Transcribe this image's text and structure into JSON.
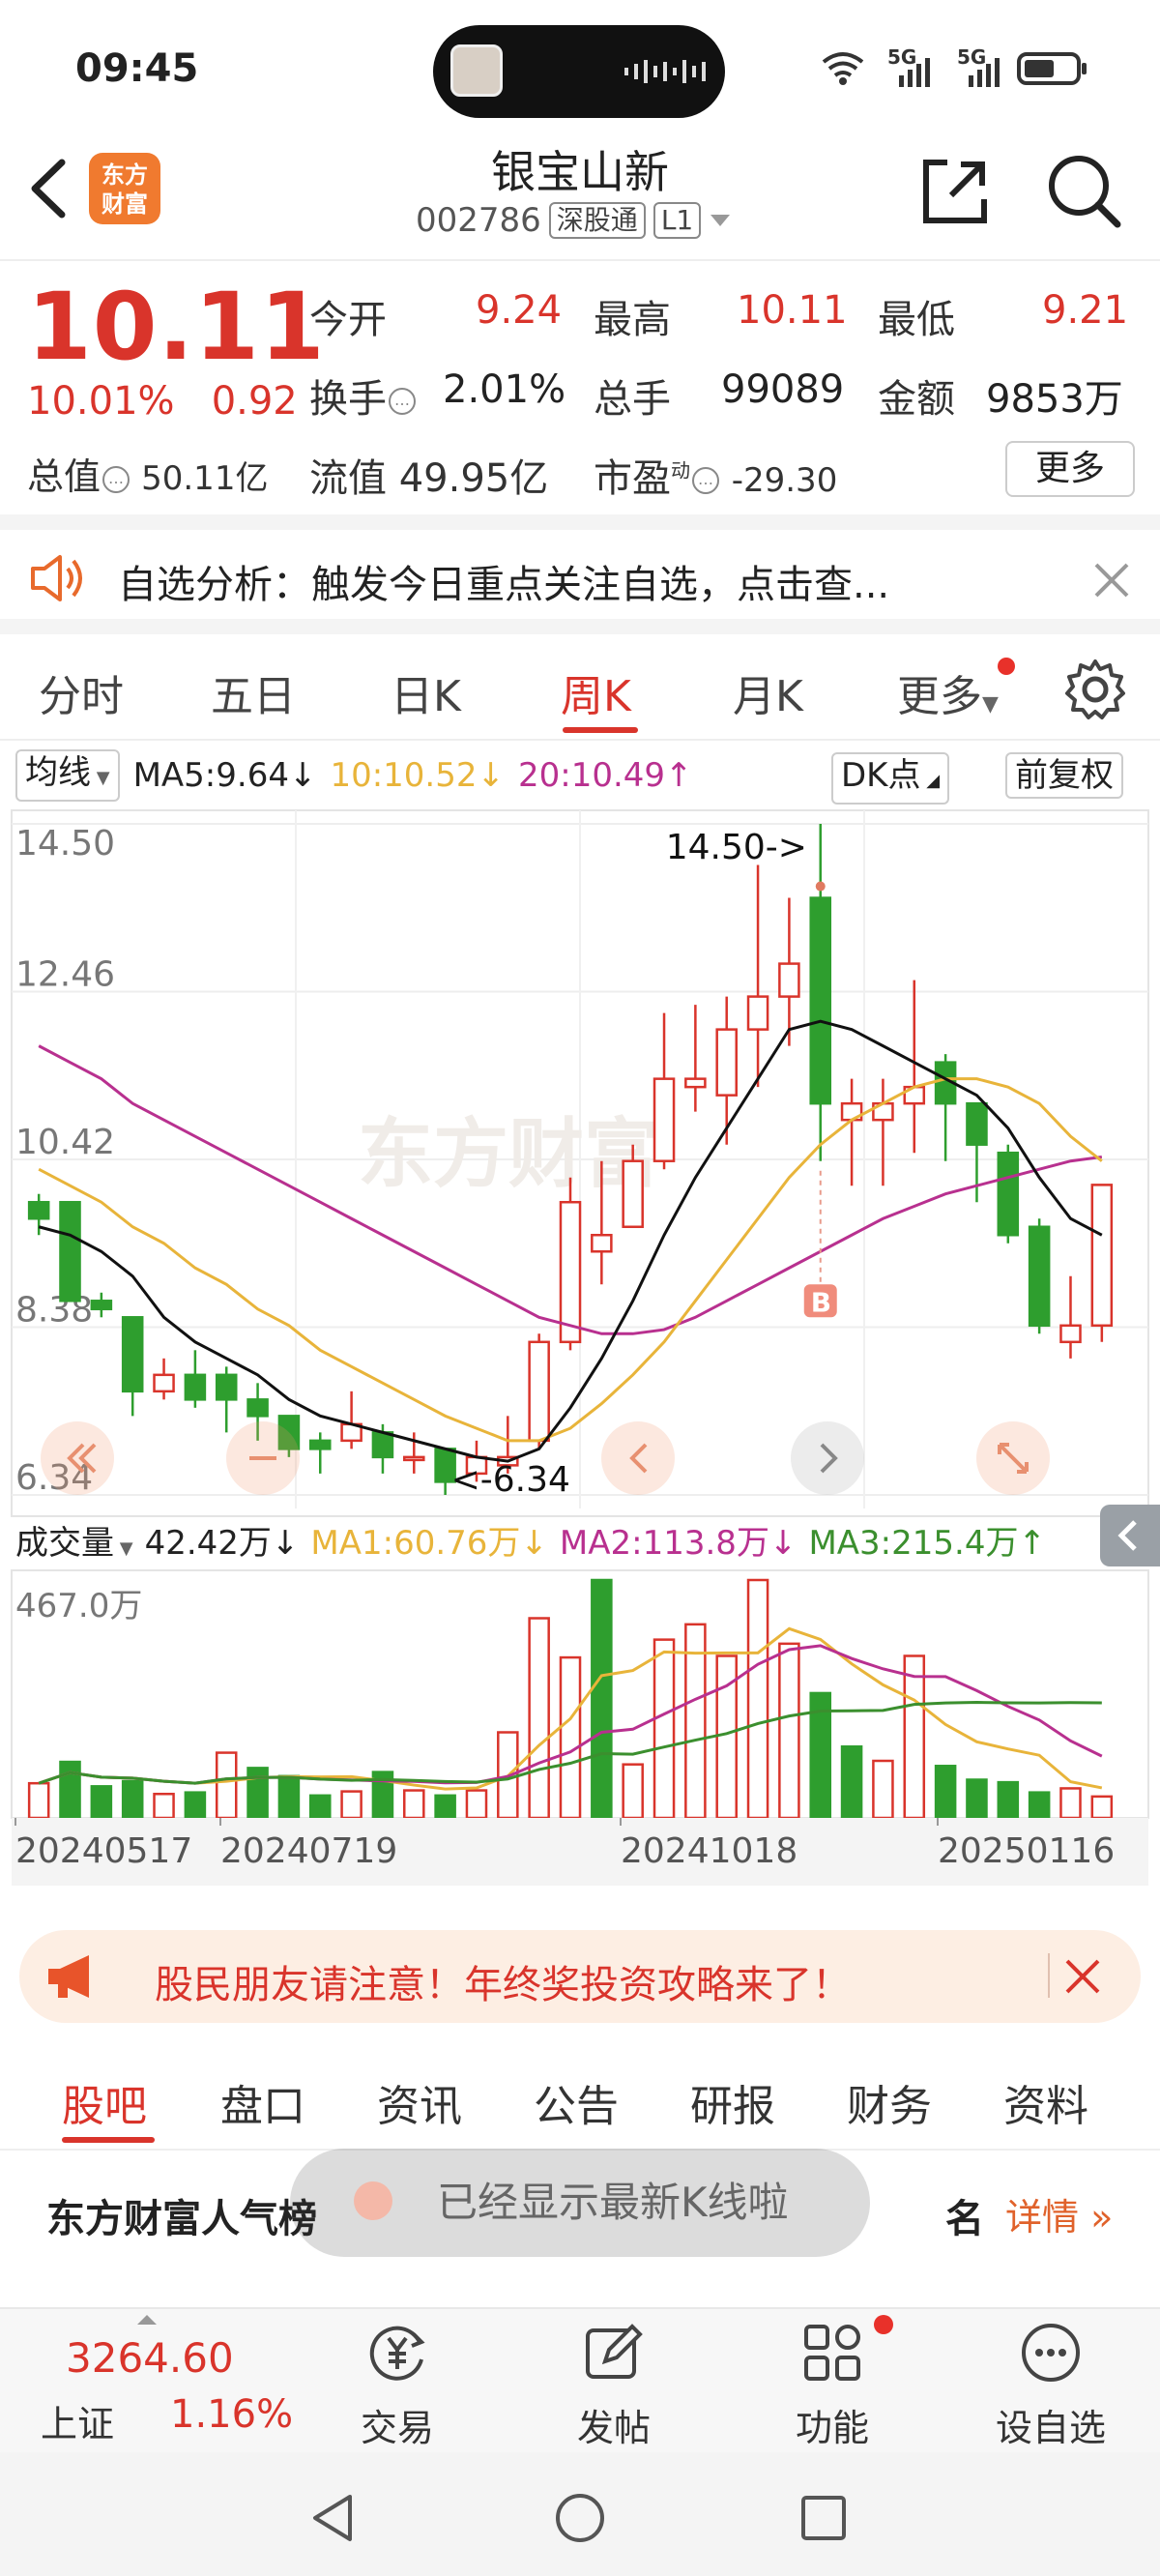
{
  "status": {
    "time": "09:45",
    "net1": "5G",
    "net2": "5G"
  },
  "header": {
    "logo_line1": "东方",
    "logo_line2": "财富",
    "title": "银宝山新",
    "code": "002786",
    "tag1": "深股通",
    "tag2": "L1"
  },
  "quote": {
    "price": "10.11",
    "change_pct": "10.01%",
    "change_amt": "0.92",
    "open_label": "今开",
    "open": "9.24",
    "high_label": "最高",
    "high": "10.11",
    "low_label": "最低",
    "low": "9.21",
    "turnover_label": "换手",
    "turnover": "2.01%",
    "volume_label": "总手",
    "volume": "99089",
    "amount_label": "金额",
    "amount": "9853万",
    "mktcap_label": "总值",
    "mktcap": "50.11亿",
    "float_label": "流值",
    "float": "49.95亿",
    "pe_label": "市盈",
    "pe_sup": "动",
    "pe": "-29.30",
    "more": "更多"
  },
  "alert": {
    "text": "自选分析：触发今日重点关注自选，点击查..."
  },
  "tabs": [
    "分时",
    "五日",
    "日K",
    "周K",
    "月K",
    "更多"
  ],
  "active_tab": "周K",
  "ma_bar": {
    "selector": "均线",
    "ma5": "MA5:9.64↓",
    "ma10": "10:10.52↓",
    "ma20": "20:10.49↑",
    "dk": "DK点",
    "fq": "前复权"
  },
  "vol_bar": {
    "selector": "成交量",
    "vol": "42.42万↓",
    "ma1": "MA1:60.76万↓",
    "ma2": "MA2:113.8万↓",
    "ma3": "MA3:215.4万↑"
  },
  "colors": {
    "up": "#d9342b",
    "down": "#2e9e2e",
    "ma5": "#111111",
    "ma10": "#e8b43a",
    "ma20": "#b8308f",
    "vma3": "#3b8f2e"
  },
  "chart_data": {
    "type": "candlestick",
    "y_ticks": [
      "14.50",
      "12.46",
      "10.42",
      "8.38",
      "6.34"
    ],
    "ylim": [
      6.34,
      14.5
    ],
    "x_labels": [
      "20240517",
      "20240719",
      "20241018",
      "20250116"
    ],
    "high_label": "14.50->",
    "low_label": "<-6.34",
    "marker": "B",
    "watermark": "东方财富",
    "candles": [
      {
        "o": 9.9,
        "c": 9.7,
        "h": 10.0,
        "l": 9.5
      },
      {
        "o": 9.9,
        "c": 8.7,
        "h": 9.9,
        "l": 8.7
      },
      {
        "o": 8.7,
        "c": 8.6,
        "h": 8.8,
        "l": 8.5
      },
      {
        "o": 8.5,
        "c": 7.6,
        "h": 8.5,
        "l": 7.3
      },
      {
        "o": 7.6,
        "c": 7.8,
        "h": 8.0,
        "l": 7.5
      },
      {
        "o": 7.8,
        "c": 7.5,
        "h": 8.1,
        "l": 7.4
      },
      {
        "o": 7.8,
        "c": 7.5,
        "h": 7.9,
        "l": 7.1
      },
      {
        "o": 7.5,
        "c": 7.3,
        "h": 7.7,
        "l": 7.0
      },
      {
        "o": 7.3,
        "c": 6.9,
        "h": 7.3,
        "l": 6.8
      },
      {
        "o": 7.0,
        "c": 6.9,
        "h": 7.1,
        "l": 6.6
      },
      {
        "o": 7.0,
        "c": 7.2,
        "h": 7.6,
        "l": 6.9
      },
      {
        "o": 7.1,
        "c": 6.8,
        "h": 7.2,
        "l": 6.6
      },
      {
        "o": 6.8,
        "c": 6.8,
        "h": 7.1,
        "l": 6.6
      },
      {
        "o": 6.9,
        "c": 6.5,
        "h": 6.9,
        "l": 6.34
      },
      {
        "o": 6.6,
        "c": 6.8,
        "h": 7.0,
        "l": 6.5
      },
      {
        "o": 6.7,
        "c": 6.8,
        "h": 7.3,
        "l": 6.6
      },
      {
        "o": 7.0,
        "c": 8.2,
        "h": 8.3,
        "l": 6.9
      },
      {
        "o": 8.2,
        "c": 9.9,
        "h": 10.2,
        "l": 8.1
      },
      {
        "o": 9.3,
        "c": 9.5,
        "h": 10.4,
        "l": 8.9
      },
      {
        "o": 9.6,
        "c": 10.4,
        "h": 10.6,
        "l": 9.6
      },
      {
        "o": 10.4,
        "c": 11.4,
        "h": 12.2,
        "l": 10.3
      },
      {
        "o": 11.3,
        "c": 11.4,
        "h": 12.3,
        "l": 11.0
      },
      {
        "o": 11.2,
        "c": 12.0,
        "h": 12.4,
        "l": 10.6
      },
      {
        "o": 12.0,
        "c": 12.4,
        "h": 14.0,
        "l": 11.3
      },
      {
        "o": 12.4,
        "c": 12.8,
        "h": 13.6,
        "l": 11.8
      },
      {
        "o": 13.6,
        "c": 11.1,
        "h": 14.5,
        "l": 10.4
      },
      {
        "o": 10.9,
        "c": 11.1,
        "h": 11.4,
        "l": 10.1
      },
      {
        "o": 10.9,
        "c": 11.1,
        "h": 11.4,
        "l": 10.1
      },
      {
        "o": 11.1,
        "c": 11.3,
        "h": 12.6,
        "l": 10.5
      },
      {
        "o": 11.6,
        "c": 11.1,
        "h": 11.7,
        "l": 10.4
      },
      {
        "o": 11.1,
        "c": 10.6,
        "h": 11.1,
        "l": 9.9
      },
      {
        "o": 10.5,
        "c": 9.5,
        "h": 10.6,
        "l": 9.4
      },
      {
        "o": 9.6,
        "c": 8.4,
        "h": 9.7,
        "l": 8.3
      },
      {
        "o": 8.2,
        "c": 8.4,
        "h": 9.0,
        "l": 8.0
      },
      {
        "o": 8.4,
        "c": 10.11,
        "h": 10.11,
        "l": 8.2
      }
    ],
    "ma5": [
      9.6,
      9.5,
      9.3,
      9.0,
      8.5,
      8.2,
      8.0,
      7.8,
      7.5,
      7.3,
      7.2,
      7.1,
      7.0,
      6.9,
      6.8,
      6.75,
      6.9,
      7.4,
      8.0,
      8.7,
      9.5,
      10.2,
      10.8,
      11.4,
      12.0,
      12.1,
      12.0,
      11.8,
      11.6,
      11.4,
      11.2,
      10.8,
      10.2,
      9.7,
      9.5
    ],
    "ma10": [
      10.3,
      10.1,
      9.9,
      9.6,
      9.4,
      9.1,
      8.9,
      8.6,
      8.4,
      8.1,
      7.9,
      7.7,
      7.5,
      7.3,
      7.15,
      7.0,
      7.0,
      7.15,
      7.45,
      7.8,
      8.2,
      8.7,
      9.2,
      9.7,
      10.2,
      10.6,
      10.9,
      11.1,
      11.3,
      11.4,
      11.4,
      11.3,
      11.1,
      10.7,
      10.4
    ],
    "ma20": [
      11.8,
      11.6,
      11.4,
      11.1,
      10.9,
      10.7,
      10.5,
      10.3,
      10.1,
      9.9,
      9.7,
      9.5,
      9.3,
      9.1,
      8.9,
      8.7,
      8.5,
      8.4,
      8.3,
      8.3,
      8.35,
      8.5,
      8.7,
      8.9,
      9.1,
      9.3,
      9.5,
      9.7,
      9.85,
      10.0,
      10.1,
      10.2,
      10.3,
      10.4,
      10.45
    ],
    "volume_max_label": "467.0万",
    "volume": [
      68,
      110,
      62,
      72,
      47,
      50,
      128,
      98,
      82,
      44,
      52,
      90,
      54,
      44,
      54,
      168,
      392,
      315,
      467,
      105,
      350,
      380,
      318,
      467,
      342,
      245,
      140,
      112,
      318,
      102,
      75,
      70,
      50,
      58,
      42
    ],
    "volume_up": [
      1,
      0,
      0,
      0,
      1,
      0,
      1,
      0,
      0,
      0,
      1,
      0,
      1,
      0,
      1,
      1,
      1,
      1,
      0,
      1,
      1,
      1,
      1,
      1,
      1,
      0,
      0,
      1,
      1,
      0,
      0,
      0,
      0,
      1,
      1
    ]
  },
  "banner": {
    "text": "股民朋友请注意！年终奖投资攻略来了！"
  },
  "bottom_tabs": [
    "股吧",
    "盘口",
    "资讯",
    "公告",
    "研报",
    "财务",
    "资料"
  ],
  "active_bottom_tab": "股吧",
  "rank": {
    "title": "东方财富人气榜",
    "suffix": "名",
    "more": "详情"
  },
  "toast": {
    "text": "已经显示最新K线啦"
  },
  "bottom_nav": {
    "index_value": "3264.60",
    "index_name": "上证",
    "index_pct": "1.16%",
    "items": [
      "交易",
      "发帖",
      "功能",
      "设自选"
    ]
  }
}
